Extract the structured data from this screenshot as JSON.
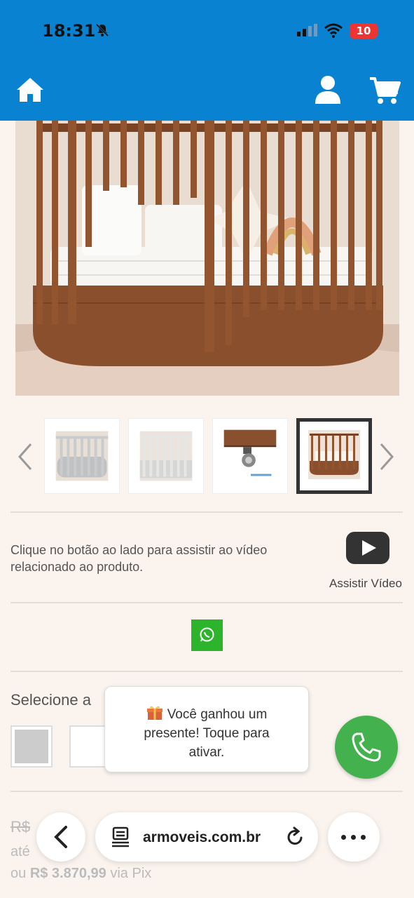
{
  "status_bar": {
    "time": "18:31",
    "battery": "10"
  },
  "header": {
    "brand_color": "#0a82d2"
  },
  "gallery": {
    "thumbnails": [
      "white-crib",
      "white-crib-front",
      "caster-wheel",
      "walnut-crib"
    ],
    "selected_index": 3
  },
  "video": {
    "description": "Clique no botão ao lado para assistir ao vídeo relacionado ao produto.",
    "button_label": "Assistir Vídeo"
  },
  "color_select": {
    "label": "Selecione a",
    "swatches": [
      "#cccccc",
      "#ffffff"
    ]
  },
  "price": {
    "old": "R$",
    "installment_prefix": "até",
    "pix_prefix": "ou",
    "pix_value": "R$ 3.870,99",
    "pix_suffix": "via Pix"
  },
  "toast": {
    "text": "Você ganhou um presente! Toque para ativar."
  },
  "browser": {
    "url": "armoveis.com.br"
  },
  "colors": {
    "whatsapp": "#2cb52c",
    "phone_fab": "#43b14d"
  }
}
